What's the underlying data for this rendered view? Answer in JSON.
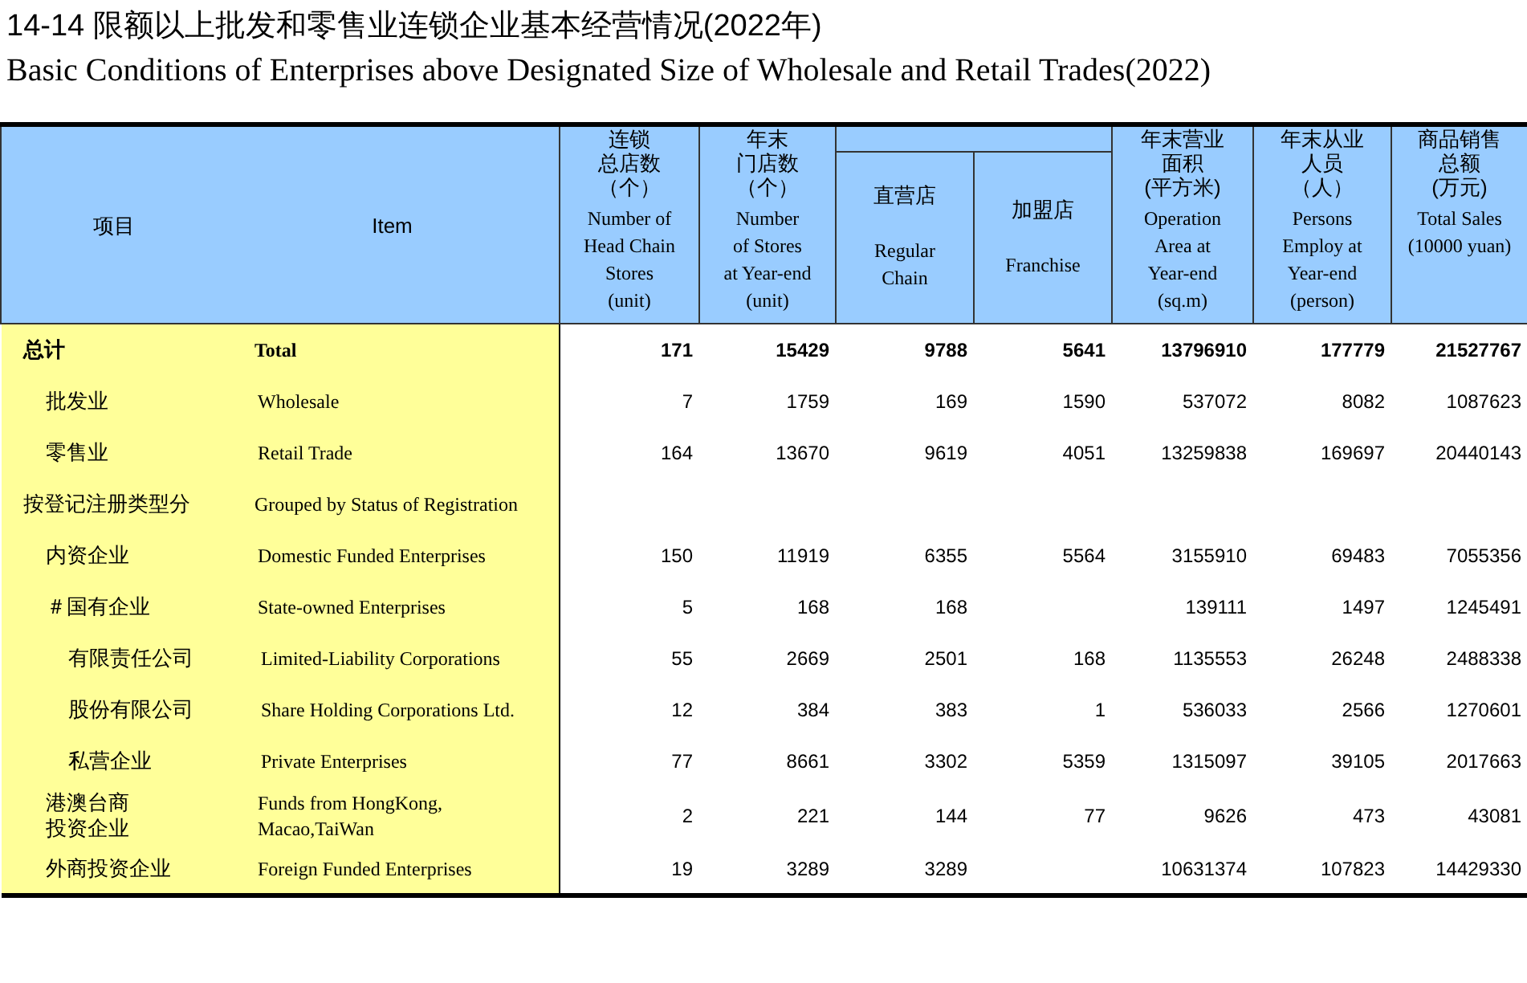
{
  "title_cn": "14-14  限额以上批发和零售业连锁企业基本经营情况(2022年)",
  "title_en": "Basic Conditions of Enterprises above Designated Size of Wholesale and Retail Trades(2022)",
  "table": {
    "header": {
      "item_cn": "项目",
      "item_en": "Item",
      "columns": [
        {
          "kind": "single",
          "cn": [
            "连锁",
            "总店数",
            "（个）"
          ],
          "en": "Number of\nHead Chain\nStores\n(unit)"
        },
        {
          "kind": "single",
          "cn": [
            "年末",
            "门店数",
            "（个）"
          ],
          "en": "Number\nof Stores\nat Year-end\n(unit)"
        },
        {
          "kind": "group",
          "columns": [
            {
              "cn": [
                "直营店"
              ],
              "en": "Regular\nChain"
            },
            {
              "cn": [
                "加盟店"
              ],
              "en": "Franchise"
            }
          ]
        },
        {
          "kind": "single",
          "cn": [
            "年末营业",
            "面积",
            "(平方米)"
          ],
          "en": "Operation\nArea at\nYear-end\n(sq.m)"
        },
        {
          "kind": "single",
          "cn": [
            "年末从业",
            "人员",
            "（人）"
          ],
          "en": "Persons\nEmploy at\nYear-end\n(person)"
        },
        {
          "kind": "single",
          "cn": [
            "商品销售",
            "总额",
            "(万元)"
          ],
          "en": "Total Sales\n(10000 yuan)"
        }
      ]
    },
    "rows": [
      {
        "kind": "total",
        "cn": [
          "总计"
        ],
        "en": "Total",
        "values": [
          "171",
          "15429",
          [
            "9788",
            "5641"
          ],
          "13796910",
          "177779",
          "21527767"
        ],
        "children": [
          {
            "kind": "item",
            "cn": [
              "批发业"
            ],
            "en": "Wholesale",
            "values": [
              "7",
              "1759",
              [
                "169",
                "1590"
              ],
              "537072",
              "8082",
              "1087623"
            ]
          },
          {
            "kind": "item",
            "cn": [
              "零售业"
            ],
            "en": "Retail Trade",
            "values": [
              "164",
              "13670",
              [
                "9619",
                "4051"
              ],
              "13259838",
              "169697",
              "20440143"
            ]
          }
        ]
      },
      {
        "kind": "group",
        "cn": [
          "按登记注册类型分"
        ],
        "en": "Grouped by Status of Registration",
        "children": [
          {
            "kind": "item",
            "cn": [
              "内资企业"
            ],
            "en": "Domestic Funded Enterprises",
            "values": [
              "150",
              "11919",
              [
                "6355",
                "5564"
              ],
              "3155910",
              "69483",
              "7055356"
            ]
          },
          {
            "kind": "item",
            "cn": [
              "＃国有企业"
            ],
            "en": "State-owned Enterprises",
            "values": [
              "5",
              "168",
              [
                "168"
              ],
              "139111",
              "1497",
              "1245491"
            ],
            "children": [
              {
                "kind": "item",
                "cn": [
                  "有限责任公司"
                ],
                "en": "Limited-Liability Corporations",
                "values": [
                  "55",
                  "2669",
                  [
                    "2501",
                    "168"
                  ],
                  "1135553",
                  "26248",
                  "2488338"
                ]
              },
              {
                "kind": "item",
                "cn": [
                  "股份有限公司"
                ],
                "en": "Share Holding Corporations Ltd.",
                "values": [
                  "12",
                  "384",
                  [
                    "383",
                    "1"
                  ],
                  "536033",
                  "2566",
                  "1270601"
                ]
              },
              {
                "kind": "item",
                "cn": [
                  "私营企业"
                ],
                "en": "Private Enterprises",
                "values": [
                  "77",
                  "8661",
                  [
                    "3302",
                    "5359"
                  ],
                  "1315097",
                  "39105",
                  "2017663"
                ]
              }
            ]
          },
          {
            "kind": "item",
            "cn": [
              "港澳台商",
              "投资企业"
            ],
            "en": "Funds from HongKong,\nMacao,TaiWan",
            "values": [
              "2",
              "221",
              [
                "144",
                "77"
              ],
              "9626",
              "473",
              "43081"
            ]
          },
          {
            "kind": "item",
            "cn": [
              "外商投资企业"
            ],
            "en": "Foreign Funded Enterprises",
            "values": [
              "19",
              "3289",
              [
                "3289"
              ],
              "10631374",
              "107823",
              "14429330"
            ]
          }
        ]
      }
    ]
  }
}
